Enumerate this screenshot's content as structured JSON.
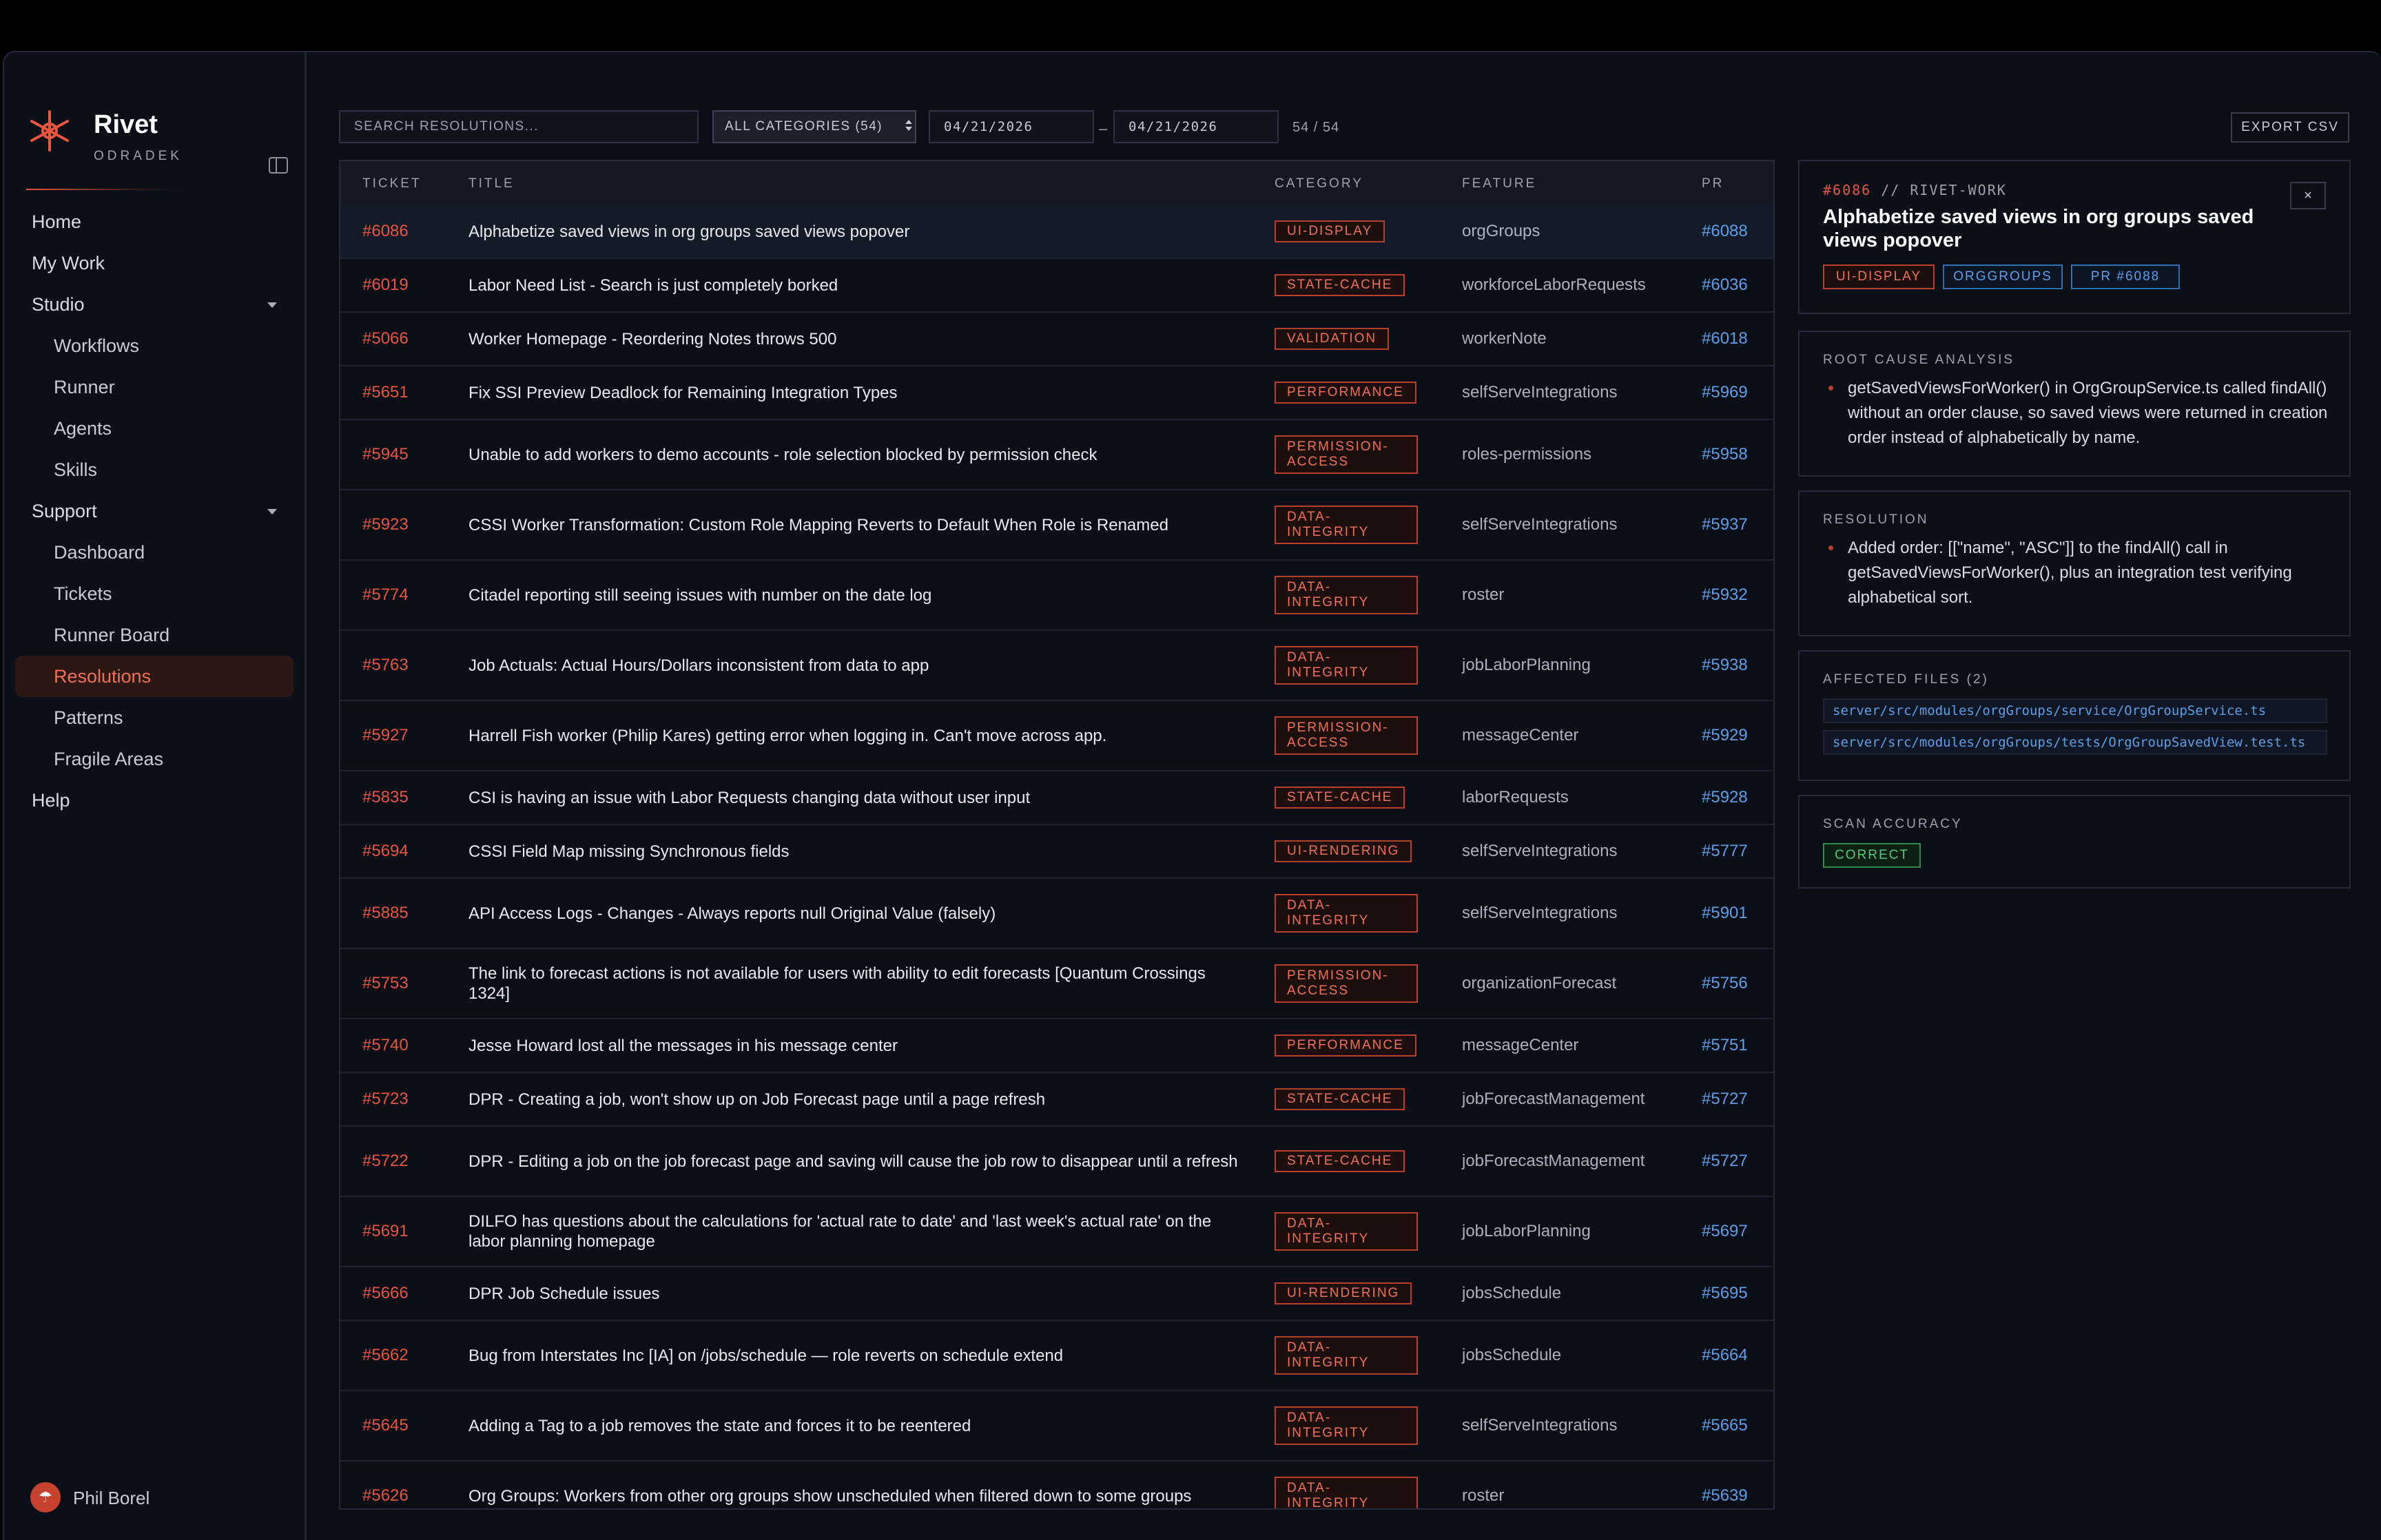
{
  "brand": {
    "name": "Rivet",
    "subtitle": "ODRADEK"
  },
  "nav": {
    "home": "Home",
    "my_work": "My Work",
    "studio": "Studio",
    "studio_items": [
      "Workflows",
      "Runner",
      "Agents",
      "Skills"
    ],
    "support": "Support",
    "support_items": [
      "Dashboard",
      "Tickets",
      "Runner Board",
      "Resolutions",
      "Patterns",
      "Fragile Areas"
    ],
    "help": "Help",
    "active": "Resolutions"
  },
  "user": {
    "name": "Phil Borel"
  },
  "toolbar": {
    "search_placeholder": "SEARCH RESOLUTIONS...",
    "category_select": "ALL CATEGORIES (54)",
    "date_from": "04/21/2026",
    "date_sep": "–",
    "date_to": "04/21/2026",
    "count": "54 / 54",
    "export_label": "EXPORT CSV"
  },
  "table": {
    "headers": {
      "ticket": "TICKET",
      "title": "TITLE",
      "category": "CATEGORY",
      "feature": "FEATURE",
      "pr": "PR"
    },
    "rows": [
      {
        "ticket": "#6086",
        "title": "Alphabetize saved views in org groups saved views popover",
        "category": "UI-DISPLAY",
        "feature": "orgGroups",
        "pr": "#6088"
      },
      {
        "ticket": "#6019",
        "title": "Labor Need List - Search is just completely borked",
        "category": "STATE-CACHE",
        "feature": "workforceLaborRequests",
        "pr": "#6036"
      },
      {
        "ticket": "#5066",
        "title": "Worker Homepage - Reordering Notes throws 500",
        "category": "VALIDATION",
        "feature": "workerNote",
        "pr": "#6018"
      },
      {
        "ticket": "#5651",
        "title": "Fix SSI Preview Deadlock for Remaining Integration Types",
        "category": "PERFORMANCE",
        "feature": "selfServeIntegrations",
        "pr": "#5969"
      },
      {
        "ticket": "#5945",
        "title": "Unable to add workers to demo accounts - role selection blocked by permission check",
        "category": "PERMISSION-ACCESS",
        "feature": "roles-permissions",
        "pr": "#5958"
      },
      {
        "ticket": "#5923",
        "title": "CSSI Worker Transformation: Custom Role Mapping Reverts to Default When Role is Renamed",
        "category": "DATA-INTEGRITY",
        "feature": "selfServeIntegrations",
        "pr": "#5937"
      },
      {
        "ticket": "#5774",
        "title": "Citadel reporting still seeing issues with number on the date log",
        "category": "DATA-INTEGRITY",
        "feature": "roster",
        "pr": "#5932"
      },
      {
        "ticket": "#5763",
        "title": "Job Actuals: Actual Hours/Dollars inconsistent from data to app",
        "category": "DATA-INTEGRITY",
        "feature": "jobLaborPlanning",
        "pr": "#5938"
      },
      {
        "ticket": "#5927",
        "title": "Harrell Fish worker (Philip Kares) getting error when logging in. Can't move across app.",
        "category": "PERMISSION-ACCESS",
        "feature": "messageCenter",
        "pr": "#5929"
      },
      {
        "ticket": "#5835",
        "title": "CSI is having an issue with Labor Requests changing data without user input",
        "category": "STATE-CACHE",
        "feature": "laborRequests",
        "pr": "#5928"
      },
      {
        "ticket": "#5694",
        "title": "CSSI Field Map missing Synchronous fields",
        "category": "UI-RENDERING",
        "feature": "selfServeIntegrations",
        "pr": "#5777"
      },
      {
        "ticket": "#5885",
        "title": "API Access Logs - Changes - Always reports null Original Value (falsely)",
        "category": "DATA-INTEGRITY",
        "feature": "selfServeIntegrations",
        "pr": "#5901"
      },
      {
        "ticket": "#5753",
        "title": "The link to forecast actions is not available for users with ability to edit forecasts [Quantum Crossings 1324]",
        "category": "PERMISSION-ACCESS",
        "feature": "organizationForecast",
        "pr": "#5756"
      },
      {
        "ticket": "#5740",
        "title": "Jesse Howard lost all the messages in his message center",
        "category": "PERFORMANCE",
        "feature": "messageCenter",
        "pr": "#5751"
      },
      {
        "ticket": "#5723",
        "title": "DPR - Creating a job, won't show up on Job Forecast page until a page refresh",
        "category": "STATE-CACHE",
        "feature": "jobForecastManagement",
        "pr": "#5727"
      },
      {
        "ticket": "#5722",
        "title": "DPR - Editing a job on the job forecast page and saving will cause the job row to disappear until a refresh",
        "category": "STATE-CACHE",
        "feature": "jobForecastManagement",
        "pr": "#5727"
      },
      {
        "ticket": "#5691",
        "title": "DILFO has questions about the calculations for 'actual rate to date' and 'last week's actual rate' on the labor planning homepage",
        "category": "DATA-INTEGRITY",
        "feature": "jobLaborPlanning",
        "pr": "#5697"
      },
      {
        "ticket": "#5666",
        "title": "DPR Job Schedule issues",
        "category": "UI-RENDERING",
        "feature": "jobsSchedule",
        "pr": "#5695"
      },
      {
        "ticket": "#5662",
        "title": "Bug from Interstates Inc [IA] on /jobs/schedule — role reverts on schedule extend",
        "category": "DATA-INTEGRITY",
        "feature": "jobsSchedule",
        "pr": "#5664"
      },
      {
        "ticket": "#5645",
        "title": "Adding a Tag to a job removes the state and forces it to be reentered",
        "category": "DATA-INTEGRITY",
        "feature": "selfServeIntegrations",
        "pr": "#5665"
      },
      {
        "ticket": "#5626",
        "title": "Org Groups: Workers from other org groups show unscheduled when filtered down to some groups",
        "category": "DATA-INTEGRITY",
        "feature": "roster",
        "pr": "#5639"
      }
    ]
  },
  "detail": {
    "ticket": "#6086",
    "source": "// RIVET-WORK",
    "title": "Alphabetize saved views in org groups saved views popover",
    "close": "×",
    "tags": [
      "UI-DISPLAY",
      "ORGGROUPS",
      "PR #6088"
    ],
    "root_cause_label": "ROOT CAUSE ANALYSIS",
    "root_cause": "getSavedViewsForWorker() in OrgGroupService.ts called findAll() without an order clause, so saved views were returned in creation order instead of alphabetically by name.",
    "resolution_label": "RESOLUTION",
    "resolution": "Added order: [[\"name\", \"ASC\"]] to the findAll() call in getSavedViewsForWorker(), plus an integration test verifying alphabetical sort.",
    "files_label": "AFFECTED FILES (2)",
    "files": [
      "server/src/modules/orgGroups/service/OrgGroupService.ts",
      "server/src/modules/orgGroups/tests/OrgGroupSavedView.test.ts"
    ],
    "accuracy_label": "SCAN ACCURACY",
    "accuracy": "CORRECT"
  },
  "colors": {
    "accent": "#e8553f",
    "link": "#5b9fe8",
    "success": "#4fc97a",
    "background": "#0a0e16"
  },
  "icons": {
    "logo": "rivet-asterisk-icon",
    "collapse": "sidebar-collapse-icon",
    "avatar": "user-avatar-icon"
  }
}
